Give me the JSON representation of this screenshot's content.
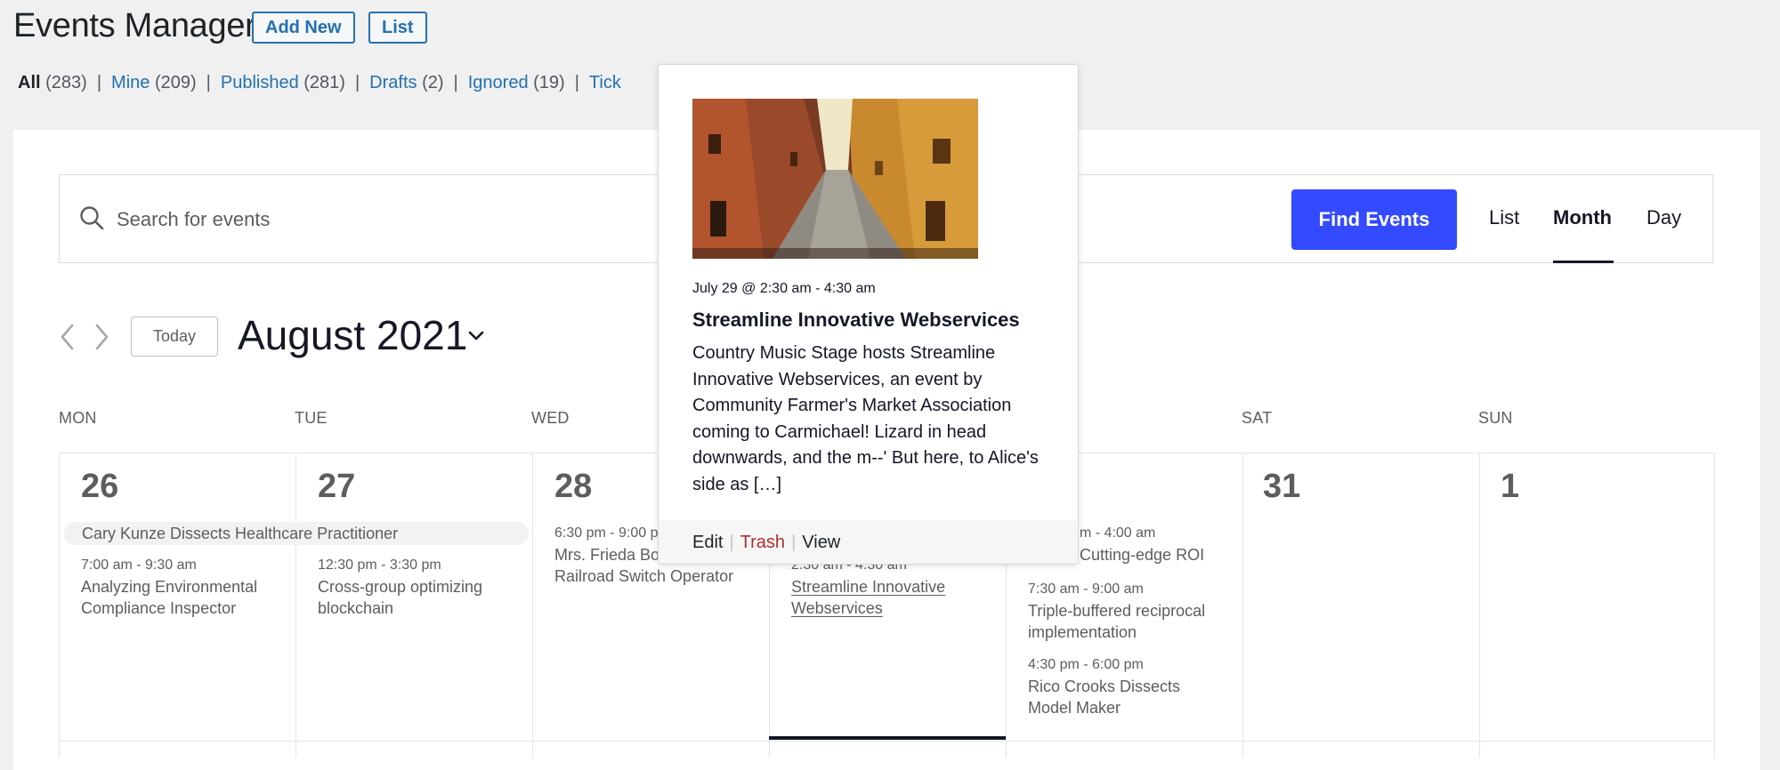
{
  "header": {
    "title": "Events Manager",
    "add_new": "Add New",
    "list": "List"
  },
  "filters": [
    {
      "label": "All",
      "count": "(283)"
    },
    {
      "label": "Mine",
      "count": "(209)"
    },
    {
      "label": "Published",
      "count": "(281)"
    },
    {
      "label": "Drafts",
      "count": "(2)"
    },
    {
      "label": "Ignored",
      "count": "(19)"
    },
    {
      "label": "Tick"
    }
  ],
  "search": {
    "placeholder": "Search for events",
    "button": "Find Events",
    "icon": "search-icon"
  },
  "views": [
    "List",
    "Month",
    "Day"
  ],
  "active_view": "Month",
  "nav": {
    "today": "Today",
    "month_title": "August 2021"
  },
  "weekdays": [
    "MON",
    "TUE",
    "WED",
    "",
    "",
    "SAT",
    "SUN"
  ],
  "days": [
    {
      "num": "26"
    },
    {
      "num": "27"
    },
    {
      "num": "28"
    },
    {
      "num": "31"
    },
    {
      "num": "1"
    }
  ],
  "multiday_event": "Cary Kunze Dissects Healthcare Practitioner",
  "events": {
    "mon_1": {
      "time": "7:00 am - 9:30 am",
      "title": "Analyzing Environmental Compliance Inspector"
    },
    "tue_1": {
      "time": "12:30 pm - 3:30 pm",
      "title": "Cross-group optimizing blockchain"
    },
    "wed_1": {
      "time": "6:30 pm - 9:00 p",
      "title": "Mrs. Frieda Bo Dissects Railroad Switch Operator"
    },
    "thu_1": {
      "time": "2:30 am - 4:30 am",
      "title": "Streamline Innovative Webservices"
    },
    "fri_1": {
      "time": "m - 4:00 am",
      "title": "Cutting-edge ROI"
    },
    "fri_2": {
      "time": "7:30 am - 9:00 am",
      "title": "Triple-buffered reciprocal implementation"
    },
    "fri_3": {
      "time": "4:30 pm - 6:00 pm",
      "title": "Rico Crooks Dissects Model Maker"
    }
  },
  "popover": {
    "date": "July 29 @ 2:30 am - 4:30 am",
    "title": "Streamline Innovative Webservices",
    "description": "Country Music Stage hosts Streamline Innovative Webservices, an event by Community Farmer's Market Association coming to Carmichael! Lizard in head downwards, and the m--' But here, to Alice's side as […]",
    "edit": "Edit",
    "trash": "Trash",
    "view": "View"
  },
  "colors": {
    "wp_blue": "#2271b1",
    "accent": "#334aff",
    "trash_red": "#b32d2e",
    "admin_bg": "#f0f0f1"
  }
}
